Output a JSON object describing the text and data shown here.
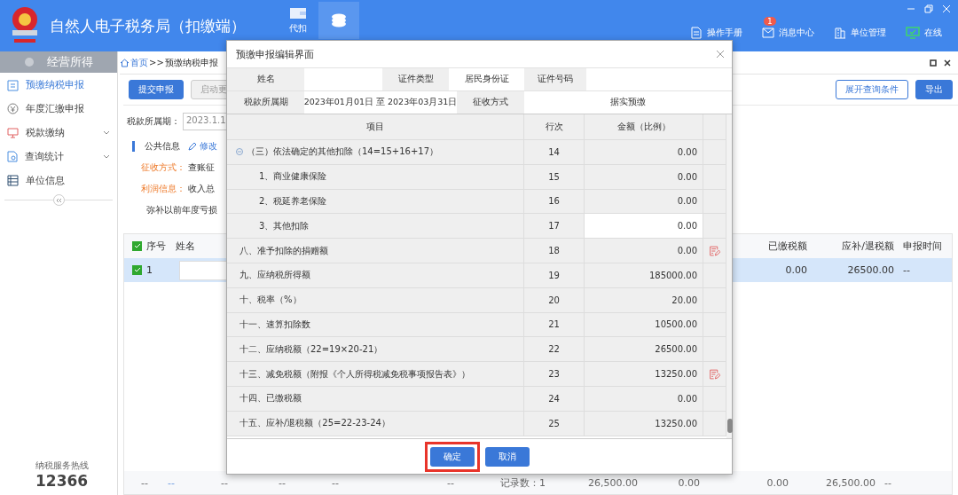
{
  "header": {
    "title": "自然人电子税务局（扣缴端）",
    "nav_tabs": [
      {
        "label": "代扣",
        "selected": false
      },
      {
        "selected": true
      }
    ],
    "tools": [
      {
        "kind": "manual",
        "label": "操作手册"
      },
      {
        "kind": "message",
        "label": "消息中心",
        "badge": "1"
      },
      {
        "kind": "unit",
        "label": "单位管理"
      },
      {
        "kind": "online",
        "label": "在线"
      }
    ]
  },
  "sidebar": {
    "title": "经营所得",
    "items": [
      {
        "kind": "declare",
        "label": "预缴纳税申报",
        "selected": true,
        "expandable": false
      },
      {
        "kind": "annual",
        "label": "年度汇缴申报",
        "selected": false,
        "expandable": false
      },
      {
        "kind": "pay",
        "label": "税款缴纳",
        "selected": false,
        "expandable": true
      },
      {
        "kind": "query",
        "label": "查询统计",
        "selected": false,
        "expandable": true
      },
      {
        "kind": "unit",
        "label": "单位信息",
        "selected": false,
        "expandable": false
      }
    ],
    "hotline_label": "纳税服务热线",
    "hotline": "12366"
  },
  "breadcrumb": {
    "home": "首页",
    "separator": ">>",
    "current": "预缴纳税申报"
  },
  "toolbar": {
    "left": [
      {
        "label": "提交申报",
        "primary": true
      },
      {
        "label": "启动更",
        "primary": false
      }
    ],
    "right": [
      {
        "label": "展开查询条件",
        "primary": false
      },
      {
        "label": "导出",
        "primary": true
      }
    ]
  },
  "form": {
    "period_label": "税款所属期：",
    "period_value": "2023.1.1",
    "section_title": "公共信息",
    "edit_link": "修改",
    "lines": [
      {
        "label": "征收方式：",
        "value": "查账征"
      },
      {
        "label": "利润信息：",
        "value": "收入总"
      }
    ],
    "loss_label": "弥补以前年度亏损"
  },
  "table": {
    "all_checked": true,
    "columns": [
      "序号",
      "姓名",
      "已缴税额",
      "应补/退税额",
      "申报时间"
    ],
    "rows": [
      {
        "checked": true,
        "selected": true,
        "index": "1",
        "paid": "0.00",
        "due": "26500.00",
        "time": "--"
      }
    ],
    "footer": [
      "--",
      "--",
      "--",
      "--",
      "--",
      "--",
      "记录数：1",
      "26,500.00",
      "0.00",
      "0.00",
      "26,500.00",
      "--"
    ]
  },
  "dialog": {
    "title": "预缴申报编辑界面",
    "info": [
      [
        {
          "kind": "label",
          "text": "姓名"
        },
        {
          "kind": "value"
        },
        {
          "kind": "label",
          "text": "证件类型"
        },
        {
          "kind": "value",
          "text": "居民身份证"
        },
        {
          "kind": "label",
          "text": "证件号码"
        },
        {
          "kind": "value"
        }
      ],
      [
        {
          "kind": "label",
          "text": "税款所属期"
        },
        {
          "kind": "value",
          "text": "2023年01月01日 至 2023年03月31日"
        },
        {
          "kind": "label",
          "text": "征收方式"
        },
        {
          "kind": "value",
          "text": "据实预缴"
        }
      ]
    ],
    "columns": [
      "项目",
      "行次",
      "金额（比例）"
    ],
    "rows": [
      {
        "item": "（三）依法确定的其他扣除（14=15+16+17）",
        "line": "14",
        "amount": "0.00",
        "editable": false,
        "edit_icon": false,
        "expanded": true,
        "children": [
          {
            "item": "1、商业健康保险",
            "line": "15",
            "amount": "0.00",
            "editable": false,
            "edit_icon": false
          },
          {
            "item": "2、税延养老保险",
            "line": "16",
            "amount": "0.00",
            "editable": false,
            "edit_icon": false
          },
          {
            "item": "3、其他扣除",
            "line": "17",
            "amount": "0.00",
            "editable": true,
            "edit_icon": false
          }
        ]
      },
      {
        "item": "八、准予扣除的捐赠额",
        "line": "18",
        "amount": "0.00",
        "editable": false,
        "edit_icon": true
      },
      {
        "item": "九、应纳税所得额",
        "line": "19",
        "amount": "185000.00",
        "editable": false,
        "edit_icon": false
      },
      {
        "item": "十、税率（%）",
        "line": "20",
        "amount": "20.00",
        "editable": false,
        "edit_icon": false
      },
      {
        "item": "十一、速算扣除数",
        "line": "21",
        "amount": "10500.00",
        "editable": false,
        "edit_icon": false
      },
      {
        "item": "十二、应纳税额（22=19×20-21）",
        "line": "22",
        "amount": "26500.00",
        "editable": false,
        "edit_icon": false
      },
      {
        "item": "十三、减免税额（附报《个人所得税减免税事项报告表》）",
        "line": "23",
        "amount": "13250.00",
        "editable": false,
        "edit_icon": true
      },
      {
        "item": "十四、已缴税额",
        "line": "24",
        "amount": "0.00",
        "editable": false,
        "edit_icon": false
      },
      {
        "item": "十五、应补/退税额（25=22-23-24）",
        "line": "25",
        "amount": "13250.00",
        "editable": false,
        "edit_icon": false
      }
    ],
    "buttons": [
      {
        "label": "确定",
        "highlighted": true
      },
      {
        "label": "取消",
        "highlighted": false
      }
    ]
  }
}
